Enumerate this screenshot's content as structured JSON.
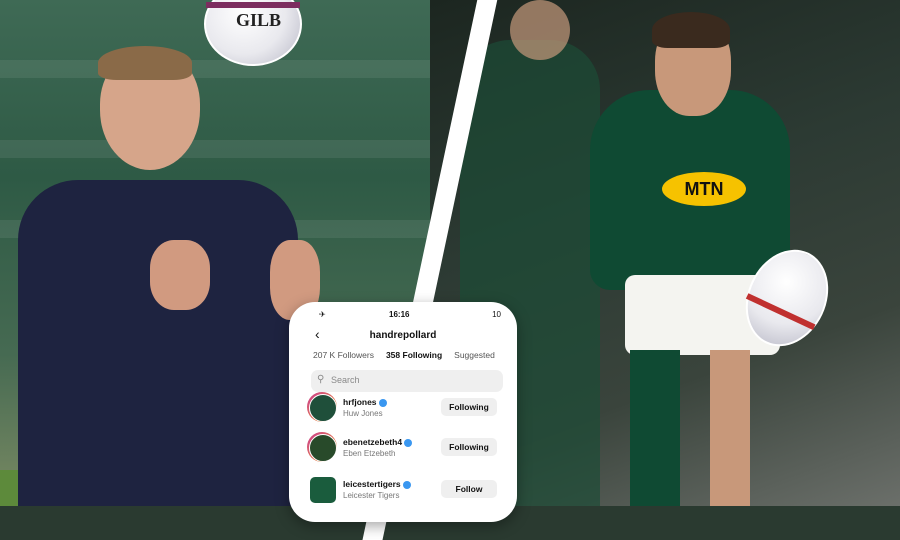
{
  "left_image": {
    "ball_text": "GILB"
  },
  "right_image": {
    "shirt_sponsor": "MTN"
  },
  "phone": {
    "status": {
      "time": "16:16",
      "carrier": "✈",
      "battery": "10"
    },
    "username": "handrepollard",
    "back_icon": "chevron-left-icon",
    "tabs": [
      {
        "label": "207 K Followers",
        "active": false
      },
      {
        "label": "358 Following",
        "active": true
      },
      {
        "label": "Suggested",
        "active": false
      }
    ],
    "search": {
      "placeholder": "Search",
      "icon": "search-icon"
    },
    "following": [
      {
        "handle": "hrfjones",
        "name": "Huw Jones",
        "button": "Following"
      },
      {
        "handle": "ebenetzebeth4",
        "name": "Eben Etzebeth",
        "button": "Following"
      },
      {
        "handle": "leicestertigers",
        "name": "Leicester Tigers",
        "button": "Follow"
      }
    ]
  },
  "colors": {
    "springbok_green": "#0f4a33",
    "mtn_yellow": "#f6c200",
    "verified_blue": "#3a97f0"
  }
}
